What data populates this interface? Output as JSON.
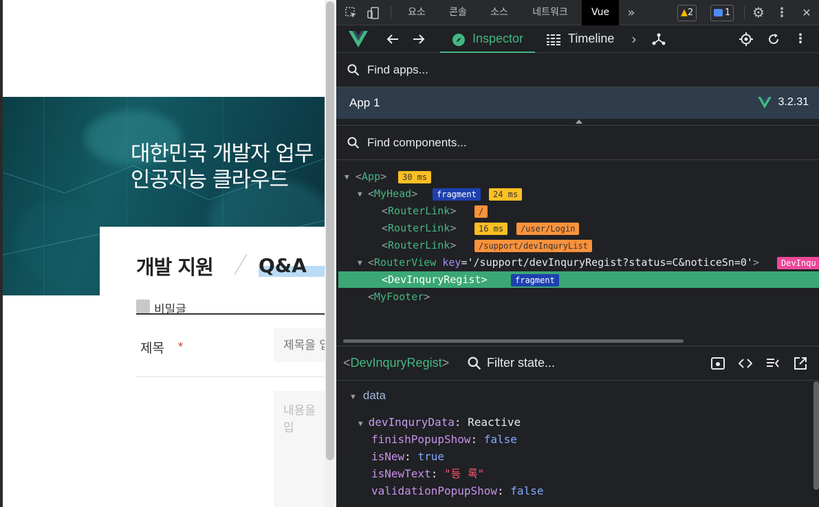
{
  "page": {
    "hero_line1": "대한민국 개발자 업무",
    "hero_line2": "인공지능 클라우드",
    "section_title": "개발 지원",
    "section_sub": "Q&A",
    "secret_label": "비밀글",
    "title_label": "제목",
    "required_mark": "*",
    "title_placeholder": "제목을 입",
    "content_placeholder": "내용을 입"
  },
  "devtools": {
    "tabs": [
      "요소",
      "콘솔",
      "소스",
      "네트워크",
      "Vue"
    ],
    "more": "»",
    "warning_count": "2",
    "message_count": "1",
    "close": "✕",
    "vue": {
      "inspector_label": "Inspector",
      "timeline_label": "Timeline",
      "find_apps_placeholder": "Find apps...",
      "app_name": "App 1",
      "vue_version": "3.2.31",
      "find_components_placeholder": "Find components...",
      "tree": {
        "app": {
          "name": "App",
          "time": "30 ms"
        },
        "myhead": {
          "name": "MyHead",
          "fragment": "fragment",
          "time": "24 ms"
        },
        "rl1": {
          "name": "RouterLink",
          "route": "/"
        },
        "rl2": {
          "name": "RouterLink",
          "time": "16 ms",
          "route": "/user/Login"
        },
        "rl3": {
          "name": "RouterLink",
          "route": "/support/devInquryList"
        },
        "routerview": {
          "name": "RouterView",
          "key_label": "key",
          "key_value": "='/support/devInquryRegist?status=C&noticeSn=0'",
          "tag": "DevInqu"
        },
        "selected": {
          "name": "DevInquryRegist",
          "fragment": "fragment"
        },
        "myfooter": {
          "name": "MyFooter"
        }
      },
      "state": {
        "component": "DevInquryRegist",
        "filter_placeholder": "Filter state...",
        "section": "data",
        "items": [
          {
            "key": "devInquryData",
            "value": "Reactive",
            "kind": "obj"
          },
          {
            "key": "finishPopupShow",
            "value": "false",
            "kind": "bool"
          },
          {
            "key": "isNew",
            "value": "true",
            "kind": "bool"
          },
          {
            "key": "isNewText",
            "value": "\"등 록\"",
            "kind": "str"
          },
          {
            "key": "validationPopupShow",
            "value": "false",
            "kind": "bool"
          }
        ]
      }
    }
  },
  "colors": {
    "vue_green": "#42b883",
    "selected_row": "#3ba776",
    "app_row": "#2e3c4b",
    "ms_badge": "#fbbf24",
    "fragment_badge": "#1e40af",
    "route_badge": "#fb923c"
  }
}
